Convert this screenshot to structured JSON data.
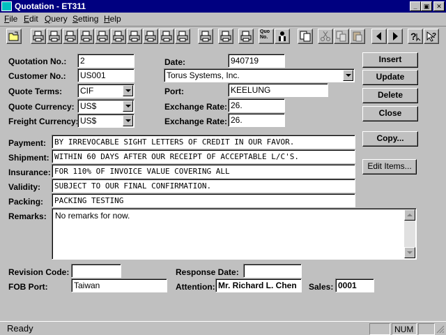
{
  "window": {
    "title": "Quotation - ET311"
  },
  "menu": [
    {
      "label": "File",
      "key": "F",
      "rest": "ile"
    },
    {
      "label": "Edit",
      "key": "E",
      "rest": "dit"
    },
    {
      "label": "Query",
      "key": "Q",
      "rest": "uery"
    },
    {
      "label": "Setting",
      "key": "S",
      "rest": "etting"
    },
    {
      "label": "Help",
      "key": "H",
      "rest": "elp"
    }
  ],
  "toolbar": {
    "quo_text": "Quo\nNo."
  },
  "form": {
    "quotation_no_label": "Quotation No.:",
    "quotation_no": "2",
    "customer_no_label": "Customer No.:",
    "customer_no": "US001",
    "quote_terms_label": "Quote Terms:",
    "quote_terms": "CIF",
    "quote_currency_label": "Quote Currency:",
    "quote_currency": "US$",
    "freight_currency_label": "Freight Currency:",
    "freight_currency": "US$",
    "date_label": "Date:",
    "date": "940719",
    "customer_name": "Torus Systems, Inc.",
    "port_label": "Port:",
    "port": "KEELUNG",
    "exchange_rate_label": "Exchange Rate:",
    "exchange_rate_1": "26.",
    "exchange_rate_2": "26.",
    "payment_label": "Payment:",
    "payment": "BY IRREVOCABLE SIGHT LETTERS OF CREDIT IN OUR FAVOR.",
    "shipment_label": "Shipment:",
    "shipment": "WITHIN 60 DAYS AFTER OUR RECEIPT OF ACCEPTABLE L/C'S.",
    "insurance_label": "Insurance:",
    "insurance": "FOR 110% OF INVOICE VALUE COVERING ALL",
    "validity_label": "Validity:",
    "validity": "SUBJECT TO OUR FINAL CONFIRMATION.",
    "packing_label": "Packing:",
    "packing": "PACKING TESTING",
    "remarks_label": "Remarks:",
    "remarks": "No remarks for now.",
    "revision_code_label": "Revision Code:",
    "revision_code": "",
    "response_date_label": "Response Date:",
    "response_date": "",
    "fob_port_label": "FOB Port:",
    "fob_port": "Taiwan",
    "attention_label": "Attention:",
    "attention": "Mr. Richard L. Chen",
    "sales_label": "Sales:",
    "sales": "0001"
  },
  "buttons": {
    "insert": "Insert",
    "update": "Update",
    "delete": "Delete",
    "close": "Close",
    "copy": "Copy...",
    "edit_items": "Edit Items..."
  },
  "status": {
    "text": "Ready",
    "num": "NUM"
  }
}
